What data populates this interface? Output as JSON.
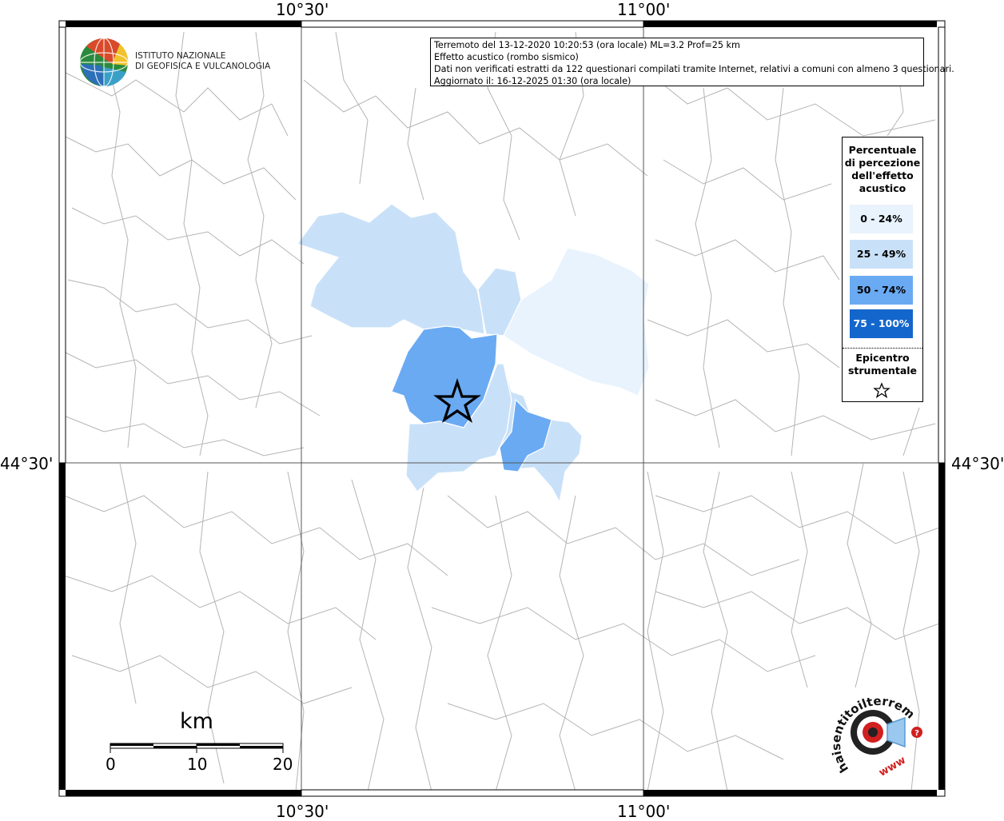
{
  "map": {
    "top_labels": [
      "10°30'",
      "11°00'"
    ],
    "bottom_labels": [
      "10°30'",
      "11°00'"
    ],
    "left_label": "44°30'",
    "right_label": "44°30'"
  },
  "info": {
    "line1": "Terremoto del 13-12-2020 10:20:53 (ora locale) ML=3.2 Prof=25 km",
    "line2": "Effetto acustico (rombo sismico)",
    "line3": "Dati non verificati estratti da 122 questionari compilati tramite Internet, relativi a comuni con almeno 3 questionari.",
    "line4": "Aggiornato il: 16-12-2025 01:30 (ora locale)"
  },
  "logo": {
    "line1": "ISTITUTO NAZIONALE",
    "line2": "DI GEOFISICA E VULCANOLOGIA"
  },
  "legend": {
    "title": [
      "Percentuale",
      "di percezione",
      "dell'effetto",
      "acustico"
    ],
    "classes": [
      {
        "label": "0 - 24%",
        "color": "#e8f3fd"
      },
      {
        "label": "25 - 49%",
        "color": "#c9e1f8"
      },
      {
        "label": "50 - 74%",
        "color": "#6aaaf3"
      },
      {
        "label": "75 - 100%",
        "color": "#1366cc"
      }
    ],
    "epicenter_label": [
      "Epicentro",
      "strumentale"
    ]
  },
  "scale": {
    "unit": "km",
    "ticks": [
      "0",
      "10",
      "20"
    ]
  },
  "brand": {
    "arc_text": "haisentitoilterremoto.it",
    "www": "www"
  }
}
